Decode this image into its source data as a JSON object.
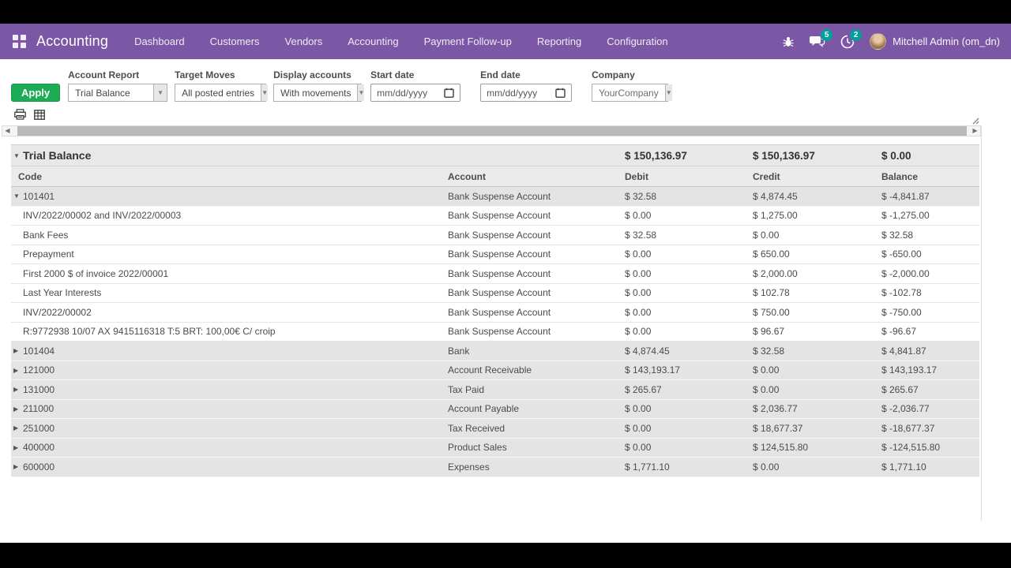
{
  "navbar": {
    "app_name": "Accounting",
    "menu": [
      {
        "label": "Dashboard"
      },
      {
        "label": "Customers"
      },
      {
        "label": "Vendors"
      },
      {
        "label": "Accounting"
      },
      {
        "label": "Payment Follow-up"
      },
      {
        "label": "Reporting"
      },
      {
        "label": "Configuration"
      }
    ],
    "messages_badge": "5",
    "activities_badge": "2",
    "user_name": "Mitchell Admin (om_dn)"
  },
  "filters": {
    "apply_label": "Apply",
    "account_report": {
      "label": "Account Report",
      "value": "Trial Balance"
    },
    "target_moves": {
      "label": "Target Moves",
      "value": "All posted entries"
    },
    "display_accounts": {
      "label": "Display accounts",
      "value": "With movements"
    },
    "start_date": {
      "label": "Start date",
      "placeholder": "mm/dd/yyyy"
    },
    "end_date": {
      "label": "End date",
      "placeholder": "mm/dd/yyyy"
    },
    "company": {
      "label": "Company",
      "value": "YourCompany"
    }
  },
  "report": {
    "title": "Trial Balance",
    "totals": {
      "debit": "$ 150,136.97",
      "credit": "$ 150,136.97",
      "balance": "$ 0.00"
    },
    "columns": [
      "Code",
      "Account",
      "Debit",
      "Credit",
      "Balance"
    ],
    "rows": [
      {
        "type": "group",
        "caret": "▼",
        "label": "101401",
        "account": "Bank Suspense Account",
        "debit": "$ 32.58",
        "credit": "$ 4,874.45",
        "balance": "$ -4,841.87"
      },
      {
        "type": "detail",
        "caret": "",
        "label": "INV/2022/00002 and INV/2022/00003",
        "account": "Bank Suspense Account",
        "debit": "$ 0.00",
        "credit": "$ 1,275.00",
        "balance": "$ -1,275.00"
      },
      {
        "type": "detail",
        "caret": "",
        "label": "Bank Fees",
        "account": "Bank Suspense Account",
        "debit": "$ 32.58",
        "credit": "$ 0.00",
        "balance": "$ 32.58"
      },
      {
        "type": "detail",
        "caret": "",
        "label": "Prepayment",
        "account": "Bank Suspense Account",
        "debit": "$ 0.00",
        "credit": "$ 650.00",
        "balance": "$ -650.00"
      },
      {
        "type": "detail",
        "caret": "",
        "label": "First 2000 $ of invoice 2022/00001",
        "account": "Bank Suspense Account",
        "debit": "$ 0.00",
        "credit": "$ 2,000.00",
        "balance": "$ -2,000.00"
      },
      {
        "type": "detail",
        "caret": "",
        "label": "Last Year Interests",
        "account": "Bank Suspense Account",
        "debit": "$ 0.00",
        "credit": "$ 102.78",
        "balance": "$ -102.78"
      },
      {
        "type": "detail",
        "caret": "",
        "label": "INV/2022/00002",
        "account": "Bank Suspense Account",
        "debit": "$ 0.00",
        "credit": "$ 750.00",
        "balance": "$ -750.00"
      },
      {
        "type": "detail",
        "caret": "",
        "label": "R:9772938 10/07 AX 9415116318 T:5 BRT: 100,00€ C/ croip",
        "account": "Bank Suspense Account",
        "debit": "$ 0.00",
        "credit": "$ 96.67",
        "balance": "$ -96.67"
      },
      {
        "type": "group",
        "caret": "▶",
        "label": "101404",
        "account": "Bank",
        "debit": "$ 4,874.45",
        "credit": "$ 32.58",
        "balance": "$ 4,841.87"
      },
      {
        "type": "group",
        "caret": "▶",
        "label": "121000",
        "account": "Account Receivable",
        "debit": "$ 143,193.17",
        "credit": "$ 0.00",
        "balance": "$ 143,193.17"
      },
      {
        "type": "group",
        "caret": "▶",
        "label": "131000",
        "account": "Tax Paid",
        "debit": "$ 265.67",
        "credit": "$ 0.00",
        "balance": "$ 265.67"
      },
      {
        "type": "group",
        "caret": "▶",
        "label": "211000",
        "account": "Account Payable",
        "debit": "$ 0.00",
        "credit": "$ 2,036.77",
        "balance": "$ -2,036.77"
      },
      {
        "type": "group",
        "caret": "▶",
        "label": "251000",
        "account": "Tax Received",
        "debit": "$ 0.00",
        "credit": "$ 18,677.37",
        "balance": "$ -18,677.37"
      },
      {
        "type": "group",
        "caret": "▶",
        "label": "400000",
        "account": "Product Sales",
        "debit": "$ 0.00",
        "credit": "$ 124,515.80",
        "balance": "$ -124,515.80"
      },
      {
        "type": "group",
        "caret": "▶",
        "label": "600000",
        "account": "Expenses",
        "debit": "$ 1,771.10",
        "credit": "$ 0.00",
        "balance": "$ 1,771.10"
      }
    ]
  },
  "colors": {
    "navbar_bg": "#7c57a5",
    "apply_green": "#1eab55",
    "badge_teal": "#00a09d"
  }
}
